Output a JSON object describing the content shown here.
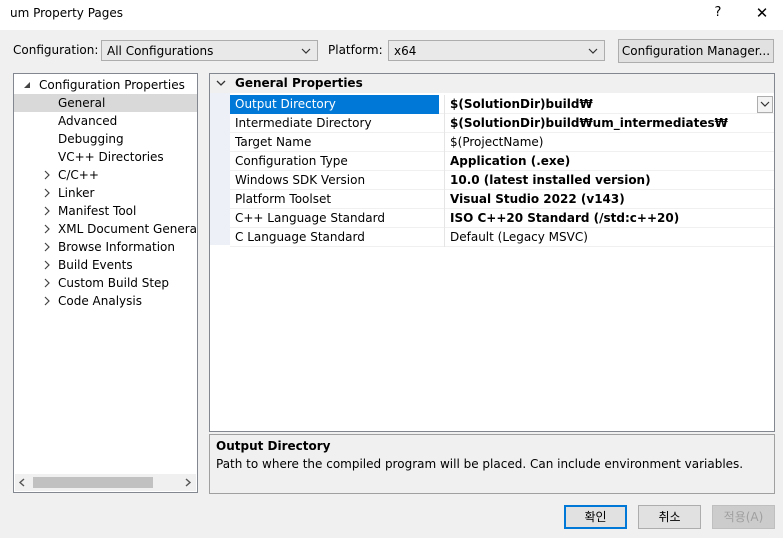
{
  "window": {
    "title": "um Property Pages",
    "help_label": "?",
    "close_label": "✕"
  },
  "toolbar": {
    "configuration_label": "Configuration:",
    "configuration_value": "All Configurations",
    "platform_label": "Platform:",
    "platform_value": "x64",
    "config_manager_label": "Configuration Manager..."
  },
  "tree": {
    "root": "Configuration Properties",
    "items": [
      {
        "label": "General",
        "expandable": false,
        "selected": true
      },
      {
        "label": "Advanced",
        "expandable": false
      },
      {
        "label": "Debugging",
        "expandable": false
      },
      {
        "label": "VC++ Directories",
        "expandable": false
      },
      {
        "label": "C/C++",
        "expandable": true
      },
      {
        "label": "Linker",
        "expandable": true
      },
      {
        "label": "Manifest Tool",
        "expandable": true
      },
      {
        "label": "XML Document Generator",
        "expandable": true
      },
      {
        "label": "Browse Information",
        "expandable": true
      },
      {
        "label": "Build Events",
        "expandable": true
      },
      {
        "label": "Custom Build Step",
        "expandable": true
      },
      {
        "label": "Code Analysis",
        "expandable": true
      }
    ]
  },
  "grid": {
    "category": "General Properties",
    "rows": [
      {
        "name": "Output Directory",
        "value": "$(SolutionDir)build₩",
        "bold": true,
        "selected": true
      },
      {
        "name": "Intermediate Directory",
        "value": "$(SolutionDir)build₩um_intermediates₩",
        "bold": true
      },
      {
        "name": "Target Name",
        "value": "$(ProjectName)",
        "bold": false
      },
      {
        "name": "Configuration Type",
        "value": "Application (.exe)",
        "bold": true
      },
      {
        "name": "Windows SDK Version",
        "value": "10.0 (latest installed version)",
        "bold": true
      },
      {
        "name": "Platform Toolset",
        "value": "Visual Studio 2022 (v143)",
        "bold": true
      },
      {
        "name": "C++ Language Standard",
        "value": "ISO C++20 Standard (/std:c++20)",
        "bold": true
      },
      {
        "name": "C Language Standard",
        "value": "Default (Legacy MSVC)",
        "bold": false
      }
    ]
  },
  "description": {
    "title": "Output Directory",
    "text": "Path to where the compiled program will be placed. Can include environment variables."
  },
  "buttons": {
    "ok": "확인",
    "cancel": "취소",
    "apply": "적용(A)"
  },
  "colors": {
    "selection": "#0078d7",
    "tree_selection": "#d9d9d9",
    "disabled_text": "#a0a0a0"
  }
}
